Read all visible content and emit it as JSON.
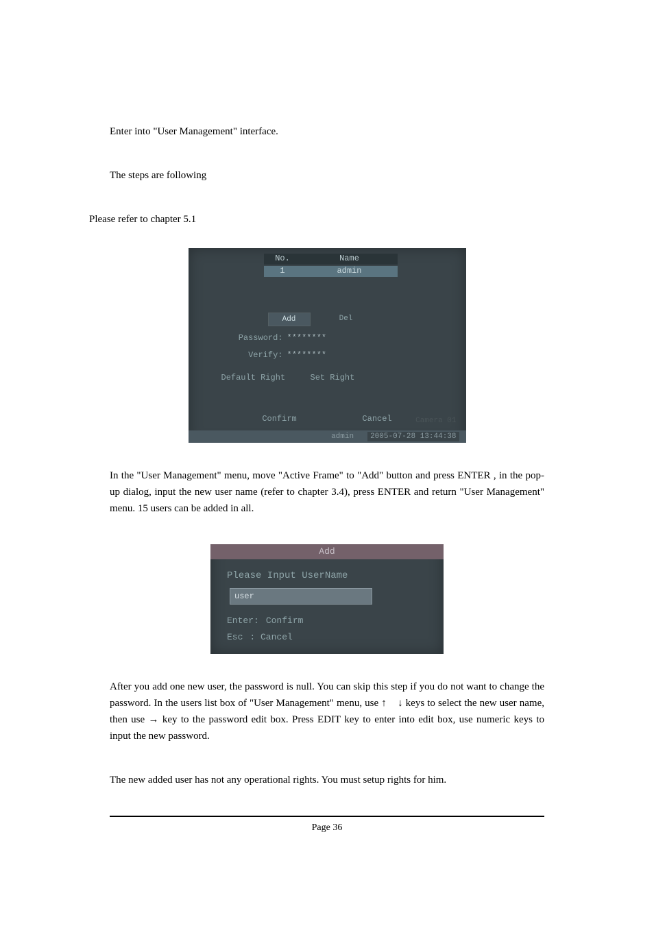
{
  "intro": {
    "line1": "Enter into \"User Management\" interface.",
    "line2": "The steps are following",
    "line3": "Please refer to chapter 5.1"
  },
  "screenshot1": {
    "col_no": "No.",
    "col_name": "Name",
    "row_no": "1",
    "row_name": "admin",
    "btn_add": "Add",
    "btn_del": "Del",
    "password_label": "Password:",
    "password_value": "********",
    "verify_label": "Verify:",
    "verify_value": "********",
    "default_right": "Default Right",
    "set_right": "Set Right",
    "confirm": "Confirm",
    "cancel": "Cancel",
    "camera": "Camera 01",
    "status_user": "admin",
    "status_time": "2005-07-28 13:44:38"
  },
  "mid_para": "In the \"User Management\" menu, move \"Active Frame\" to \"Add\" button and press ENTER , in the pop-up dialog, input the new user name (refer to chapter 3.4), press ENTER and return \"User Management\" menu. 15 users can be added in all.",
  "screenshot2": {
    "title": "Add",
    "prompt": "Please Input UserName",
    "input_value": "user",
    "hint1_key": "Enter:",
    "hint1_val": "Confirm",
    "hint2_key": "Esc",
    "hint2_val": ": Cancel"
  },
  "after_para": {
    "seg1": "After you add one new user, the password is null. You can skip this step if you do not want to change the password. In the users list box of \"User Management\" menu, use ",
    "arrow_up": "↑",
    "arrow_down": "↓",
    "seg2": " keys to select the new user name, then use ",
    "arrow_right": "→",
    "seg3": " key to the password edit box. Press EDIT key to enter into edit box, use numeric keys to input the new password."
  },
  "last_para": "The new added user has not any operational rights. You must setup rights for him.",
  "footer": "Page 36"
}
